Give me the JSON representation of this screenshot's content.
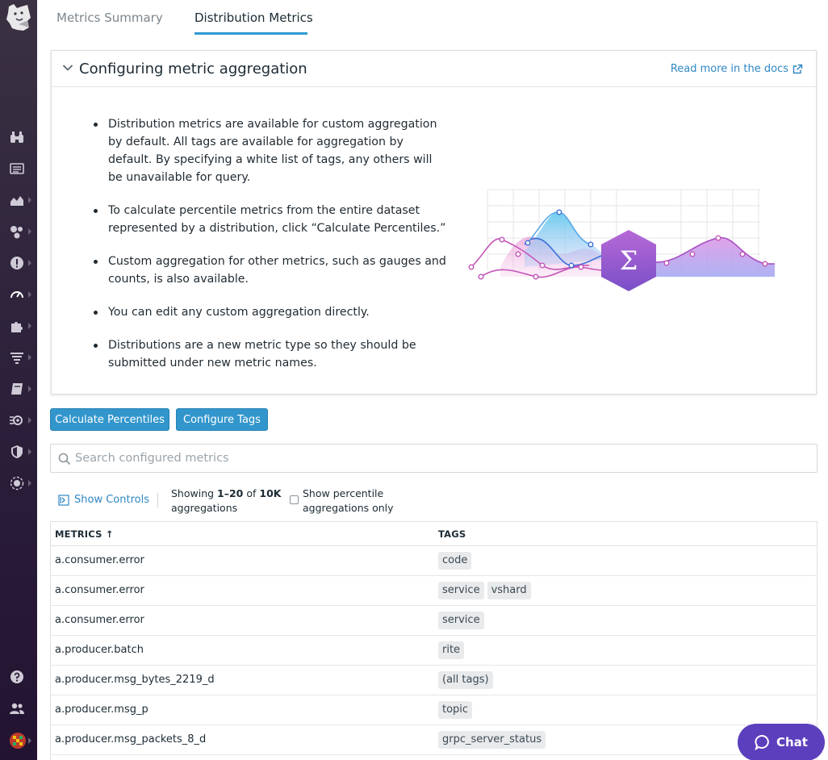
{
  "tabs": [
    {
      "label": "Metrics Summary",
      "active": false
    },
    {
      "label": "Distribution Metrics",
      "active": true
    }
  ],
  "panel": {
    "title": "Configuring metric aggregation",
    "docs_link": "Read more in the docs",
    "bullets": [
      "Distribution metrics are available for custom aggregation by default. All tags are available for aggregation by default. By specifying a white list of tags, any others will be unavailable for query.",
      "To calculate percentile metrics from the entire dataset represented by a distribution, click “Calculate Percentiles.”",
      "Custom aggregation for other metrics, such as gauges and counts, is also available.",
      "You can edit any custom aggregation directly.",
      "Distributions are a new metric type so they should be submitted under new metric names."
    ],
    "illustration_symbol": "Σ"
  },
  "actions": {
    "calculate_label": "Calculate Percentiles",
    "configure_label": "Configure Tags"
  },
  "search": {
    "placeholder": "Search configured metrics",
    "value": ""
  },
  "controls": {
    "show_controls": "Show Controls",
    "showing_prefix": "Showing ",
    "showing_range": "1–20",
    "showing_of": " of ",
    "showing_total": "10K",
    "showing_suffix": "aggregations",
    "percentile_only_label": "Show percentile aggregations only",
    "percentile_only_checked": false
  },
  "table": {
    "columns": [
      "METRICS ↑",
      "TAGS"
    ],
    "rows": [
      {
        "metric": "a.consumer.error",
        "tags": [
          "code"
        ]
      },
      {
        "metric": "a.consumer.error",
        "tags": [
          "service",
          "vshard"
        ]
      },
      {
        "metric": "a.consumer.error",
        "tags": [
          "service"
        ]
      },
      {
        "metric": "a.producer.batch",
        "tags": [
          "rite"
        ]
      },
      {
        "metric": "a.producer.msg_bytes_2219_d",
        "tags": [
          "(all tags)"
        ]
      },
      {
        "metric": "a.producer.msg_p",
        "tags": [
          "topic"
        ]
      },
      {
        "metric": "a.producer.msg_packets_8_d",
        "tags": [
          "grpc_server_status"
        ]
      }
    ]
  },
  "chat": {
    "label": "Chat"
  },
  "colors": {
    "accent": "#3296cc",
    "link": "#2f87c5",
    "sidebar": "#2b1f3a",
    "chat": "#5c3fbd",
    "tab_underline": "#2f9ad1"
  },
  "sidebar_icons": [
    "binoculars-icon",
    "list-icon",
    "area-chart-icon",
    "hexagons-icon",
    "alert-icon",
    "gauge-icon",
    "puzzle-icon",
    "filter-icon",
    "book-icon",
    "apm-icon",
    "shield-icon",
    "network-icon",
    "help-icon",
    "users-icon",
    "user-avatar"
  ]
}
